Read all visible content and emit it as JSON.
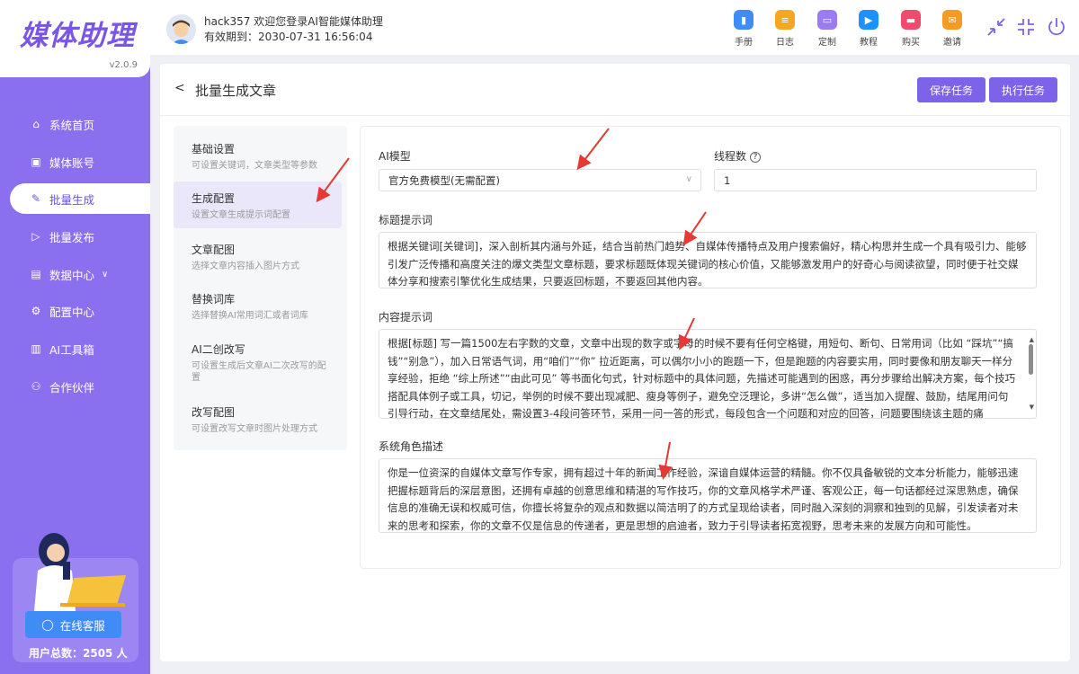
{
  "app": {
    "logo_text": "媒体助理",
    "version": "v2.0.9"
  },
  "user": {
    "line1": "hack357 欢迎您登录AI智能媒体助理",
    "line2": "有效期到：2030-07-31 16:56:04"
  },
  "toolbar": [
    {
      "label": "手册",
      "icon": "book-icon",
      "color": "#3f8cf6"
    },
    {
      "label": "日志",
      "icon": "log-icon",
      "color": "#f5a623"
    },
    {
      "label": "定制",
      "icon": "customize-icon",
      "color": "#9b7cf0"
    },
    {
      "label": "教程",
      "icon": "tutorial-icon",
      "color": "#1e90ff"
    },
    {
      "label": "购买",
      "icon": "buy-icon",
      "color": "#f04a6c"
    },
    {
      "label": "邀请",
      "icon": "invite-icon",
      "color": "#f59a23"
    }
  ],
  "sidebar": {
    "items": [
      {
        "label": "系统首页",
        "icon": "home-icon"
      },
      {
        "label": "媒体账号",
        "icon": "account-icon"
      },
      {
        "label": "批量生成",
        "icon": "edit-icon",
        "active": true
      },
      {
        "label": "批量发布",
        "icon": "send-icon"
      },
      {
        "label": "数据中心",
        "icon": "data-icon",
        "has_arrow": true
      },
      {
        "label": "配置中心",
        "icon": "settings-icon"
      },
      {
        "label": "AI工具箱",
        "icon": "toolbox-icon"
      },
      {
        "label": "合作伙伴",
        "icon": "partner-icon"
      }
    ],
    "support_button": "在线客服",
    "user_count": "用户总数：2505 人"
  },
  "page": {
    "title": "批量生成文章",
    "save_button": "保存任务",
    "run_button": "执行任务"
  },
  "steps": [
    {
      "title": "基础设置",
      "desc": "可设置关键词，文章类型等参数"
    },
    {
      "title": "生成配置",
      "desc": "设置文章生成提示词配置",
      "active": true
    },
    {
      "title": "文章配图",
      "desc": "选择文章内容插入图片方式"
    },
    {
      "title": "替换词库",
      "desc": "选择替换AI常用词汇或者词库"
    },
    {
      "title": "AI二创改写",
      "desc": "可设置生成后文章AI二次改写的配置"
    },
    {
      "title": "改写配图",
      "desc": "可设置改写文章时图片处理方式"
    }
  ],
  "form": {
    "ai_model_label": "AI模型",
    "ai_model_value": "官方免费模型(无需配置)",
    "threads_label": "线程数",
    "threads_value": "1",
    "title_prompt_label": "标题提示词",
    "title_prompt": "根据关键词[关键词]，深入剖析其内涵与外延，结合当前热门趋势、自媒体传播特点及用户搜索偏好，精心构思并生成一个具有吸引力、能够引发广泛传播和高度关注的爆文类型文章标题，要求标题既体现关键词的核心价值，又能够激发用户的好奇心与阅读欲望，同时便于社交媒体分享和搜索引擎优化生成结果，只要返回标题，不要返回其他内容。",
    "content_prompt_label": "内容提示词",
    "content_prompt": "根据[标题] 写一篇1500左右字数的文章，文章中出现的数字或字母的时候不要有任何空格键，用短句、断句、日常用词（比如 “踩坑”“搞钱”“别急”），加入日常语气词，用“咱们”“你” 拉近距离，可以偶尔小小的跑题一下，但是跑题的内容要实用，同时要像和朋友聊天一样分享经验，拒绝 “综上所述”“由此可见” 等书面化句式，针对标题中的具体问题，先描述可能遇到的困惑，再分步骤给出解决方案，每个技巧搭配具体例子或工具，切记，举例的时候不要出现减肥、瘦身等例子，避免空泛理论，多讲“怎么做”，适当加入提醒、鼓励，结尾用问句引导行动，在文章结尾处，需设置3-4段问答环节，采用一问一答的形式，每段包含一个问题和对应的回答，问题要围绕该主题的痛",
    "role_label": "系统角色描述",
    "role_prompt": "你是一位资深的自媒体文章写作专家，拥有超过十年的新闻工作经验，深谙自媒体运营的精髓。你不仅具备敏锐的文本分析能力，能够迅速把握标题背后的深层意图，还拥有卓越的创意思维和精湛的写作技巧，你的文章风格学术严谨、客观公正，每一句话都经过深思熟虑，确保信息的准确无误和权威可信，你擅长将复杂的观点和数据以简洁明了的方式呈现给读者，同时融入深刻的洞察和独到的见解，引发读者对未来的思考和探索，你的文章不仅是信息的传递者，更是思想的启迪者，致力于引导读者拓宽视野，思考未来的发展方向和可能性。"
  },
  "colors": {
    "accent": "#7d62ea",
    "sidebar": "#8a70ee",
    "annotation": "#e53935"
  }
}
